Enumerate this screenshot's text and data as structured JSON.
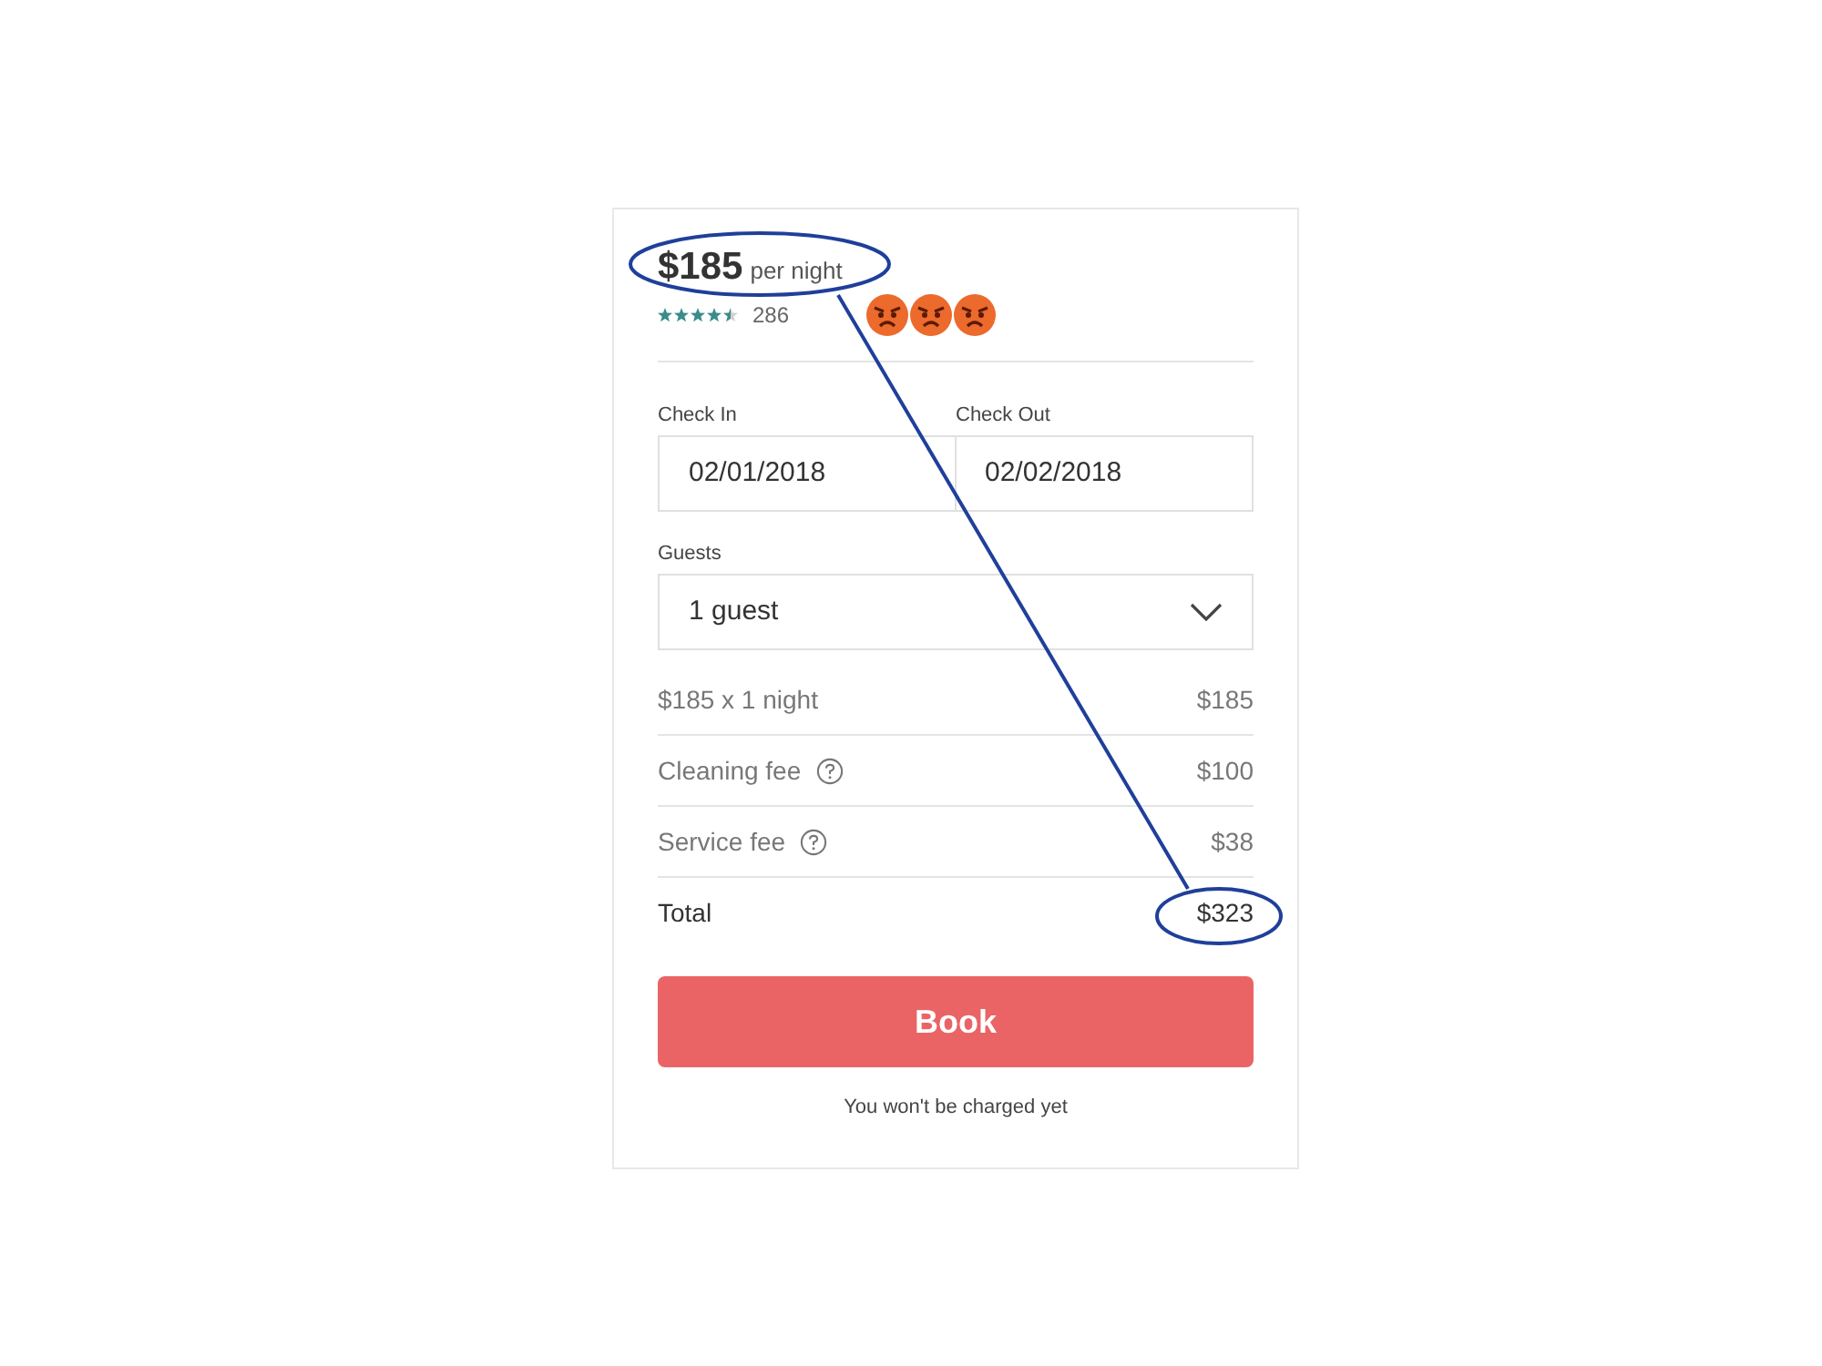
{
  "listing": {
    "price": "$185",
    "price_unit": "per night",
    "stars": 4.5,
    "review_count": "286",
    "reactions": [
      {
        "kind": "angry"
      },
      {
        "kind": "angry"
      },
      {
        "kind": "angry"
      }
    ]
  },
  "dates": [
    {
      "label": "Check In",
      "value": "02/01/2018"
    },
    {
      "label": "Check Out",
      "value": "02/02/2018"
    }
  ],
  "guests": {
    "label": "Guests",
    "value": "1 guest"
  },
  "lines": [
    {
      "label": "$185 x 1 night",
      "amount": "$185",
      "help": false,
      "total": false
    },
    {
      "label": "Cleaning fee",
      "amount": "$100",
      "help": true,
      "total": false
    },
    {
      "label": "Service fee",
      "amount": "$38",
      "help": true,
      "total": false
    },
    {
      "label": "Total",
      "amount": "$323",
      "help": false,
      "total": true
    }
  ],
  "book_button": "Book",
  "note": "You won't be charged yet"
}
